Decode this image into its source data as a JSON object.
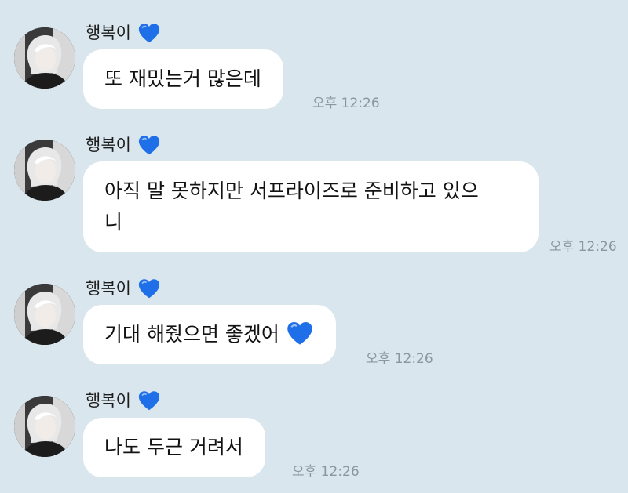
{
  "heart_color": "#1f6fe8",
  "messages": [
    {
      "sender": "행복이",
      "sender_badge": "blue-heart-icon",
      "text": "또 재밌는거 많은데",
      "time": "오후 12:26"
    },
    {
      "sender": "행복이",
      "sender_badge": "blue-heart-icon",
      "text_lines": [
        "아직 말 못하지만 서프라이즈로 준비하고 있으",
        "니"
      ],
      "time": "오후 12:26"
    },
    {
      "sender": "행복이",
      "sender_badge": "blue-heart-icon",
      "text": "기대 해줬으면 좋겠어",
      "text_emoji": "blue-heart-icon",
      "time": "오후 12:26"
    },
    {
      "sender": "행복이",
      "sender_badge": "blue-heart-icon",
      "text": "나도 두근 거려서",
      "time": "오후 12:26"
    }
  ]
}
